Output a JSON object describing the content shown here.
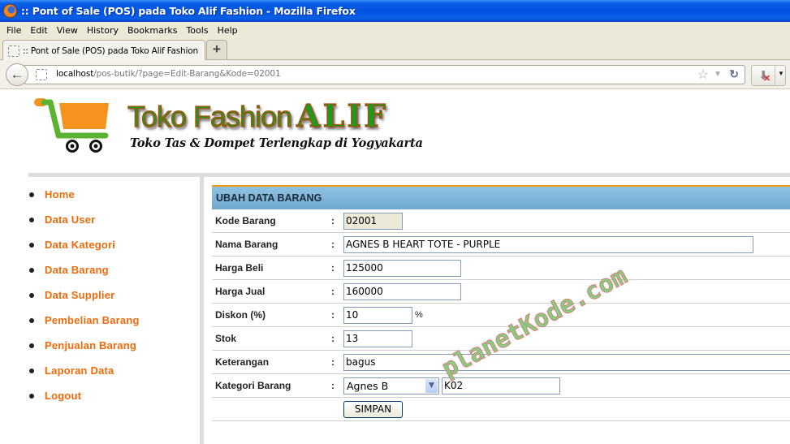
{
  "window": {
    "title": ":: Pont of Sale (POS) pada Toko Alif Fashion - Mozilla Firefox"
  },
  "menubar": {
    "items": [
      "File",
      "Edit",
      "View",
      "History",
      "Bookmarks",
      "Tools",
      "Help"
    ]
  },
  "tabs": [
    {
      "label": ":: Pont of Sale (POS) pada Toko Alif Fashion",
      "active": true
    }
  ],
  "new_tab_label": "+",
  "address": {
    "host": "localhost",
    "path": "/pos-butik/?page=Edit-Barang&Kode=02001"
  },
  "header": {
    "brand": "Toko Fashion",
    "brand_emphasis": "ALIF",
    "tagline": "Toko Tas & Dompet Terlengkap di Yogyakarta"
  },
  "sidebar": {
    "items": [
      {
        "label": "Home"
      },
      {
        "label": "Data User"
      },
      {
        "label": "Data Kategori"
      },
      {
        "label": "Data Barang"
      },
      {
        "label": "Data Supplier"
      },
      {
        "label": "Pembelian Barang"
      },
      {
        "label": "Penjualan Barang"
      },
      {
        "label": "Laporan Data"
      },
      {
        "label": "Logout"
      }
    ]
  },
  "form": {
    "title": "UBAH DATA BARANG",
    "separator": ":",
    "fields": {
      "kode": {
        "label": "Kode Barang",
        "value": "02001"
      },
      "nama": {
        "label": "Nama Barang",
        "value": "AGNES B HEART TOTE - PURPLE"
      },
      "harga_beli": {
        "label": "Harga Beli",
        "value": "125000"
      },
      "harga_jual": {
        "label": "Harga Jual",
        "value": "160000"
      },
      "diskon": {
        "label": "Diskon (%)",
        "value": "10",
        "suffix": "%"
      },
      "stok": {
        "label": "Stok",
        "value": "13"
      },
      "keterangan": {
        "label": "Keterangan",
        "value": "bagus"
      },
      "kategori": {
        "label": "Kategori Barang",
        "selected": "Agnes B",
        "code": "K02"
      }
    },
    "submit_label": "SIMPAN"
  },
  "watermark": "planetKode.com"
}
